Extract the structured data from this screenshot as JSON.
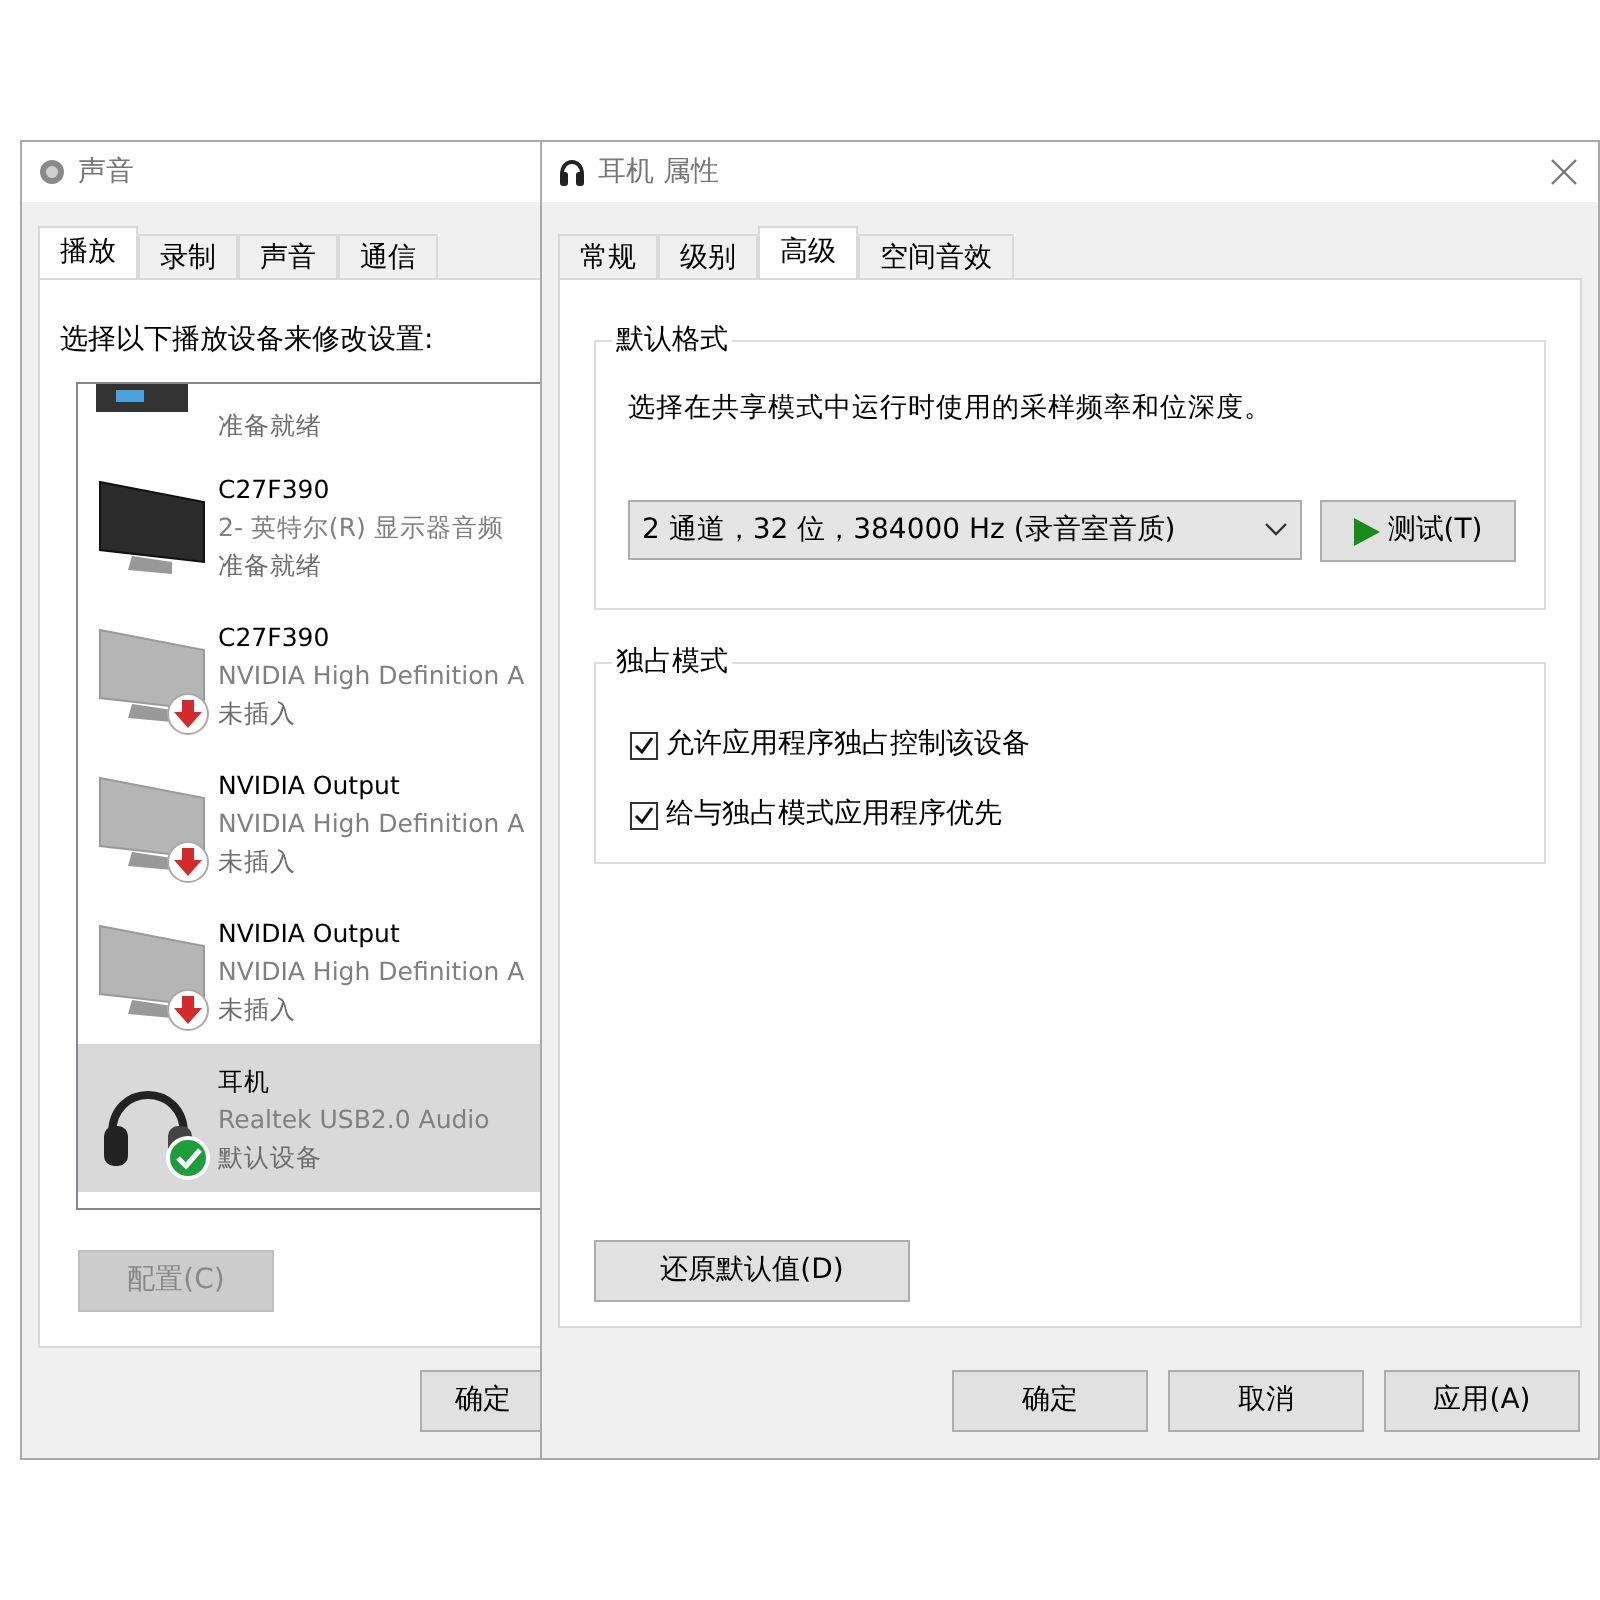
{
  "sound_window": {
    "title": "声音",
    "tabs": [
      {
        "label": "播放",
        "selected": true
      },
      {
        "label": "录制",
        "selected": false
      },
      {
        "label": "声音",
        "selected": false
      },
      {
        "label": "通信",
        "selected": false
      }
    ],
    "instruction": "选择以下播放设备来修改设置:",
    "devices": [
      {
        "kind": "receiver",
        "status": "准备就绪",
        "unplugged": false,
        "is_default": false,
        "selected": false
      },
      {
        "kind": "monitor",
        "name": "C27F390",
        "driver": "2- 英特尔(R) 显示器音频",
        "status": "准备就绪",
        "unplugged": false,
        "is_default": false,
        "selected": false
      },
      {
        "kind": "monitor",
        "name": "C27F390",
        "driver": "NVIDIA High Definition A",
        "status": "未插入",
        "unplugged": true,
        "is_default": false,
        "selected": false
      },
      {
        "kind": "monitor",
        "name": "NVIDIA Output",
        "driver": "NVIDIA High Definition A",
        "status": "未插入",
        "unplugged": true,
        "is_default": false,
        "selected": false
      },
      {
        "kind": "monitor",
        "name": "NVIDIA Output",
        "driver": "NVIDIA High Definition A",
        "status": "未插入",
        "unplugged": true,
        "is_default": false,
        "selected": false
      },
      {
        "kind": "headphones",
        "name": "耳机",
        "driver": "Realtek USB2.0 Audio",
        "status": "默认设备",
        "unplugged": false,
        "is_default": true,
        "selected": true
      }
    ],
    "configure_button": {
      "label": "配置(C)",
      "disabled": true
    },
    "ok_button": "确定"
  },
  "properties_window": {
    "title": "耳机 属性",
    "tabs": [
      {
        "label": "常规",
        "selected": false
      },
      {
        "label": "级别",
        "selected": false
      },
      {
        "label": "高级",
        "selected": true
      },
      {
        "label": "空间音效",
        "selected": false
      }
    ],
    "default_format": {
      "legend": "默认格式",
      "description": "选择在共享模式中运行时使用的采样频率和位深度。",
      "format": "2 通道，32 位，384000 Hz (录音室音质)",
      "test_button": "测试(T)"
    },
    "exclusive_mode": {
      "legend": "独占模式",
      "options": [
        {
          "label": "允许应用程序独占控制该设备",
          "checked": true
        },
        {
          "label": "给与独占模式应用程序优先",
          "checked": true
        }
      ]
    },
    "restore_button": "还原默认值(D)",
    "buttons": [
      "确定",
      "取消",
      "应用(A)"
    ]
  }
}
